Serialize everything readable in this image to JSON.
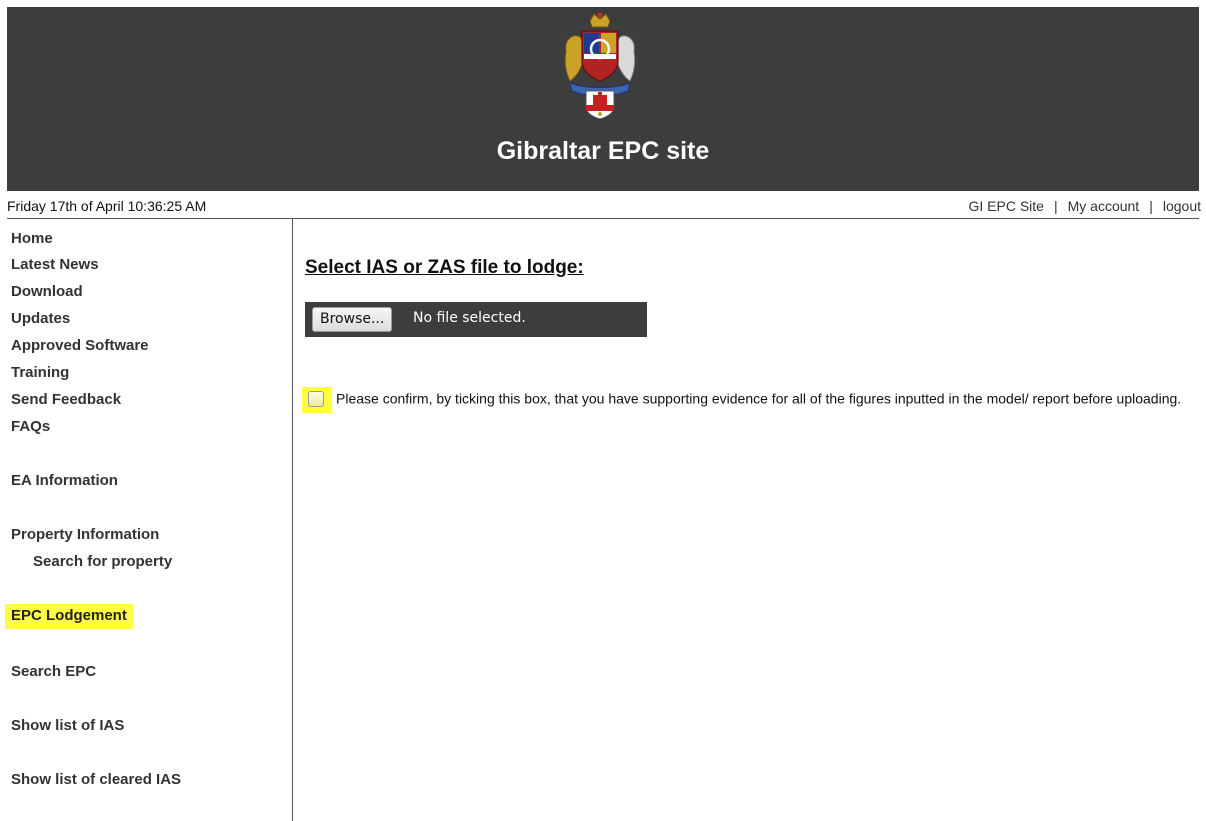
{
  "header": {
    "title": "Gibraltar EPC site",
    "crest": "Gibraltar coat of arms"
  },
  "infobar": {
    "datetime": "Friday 17th of April 10:36:25 AM",
    "links": [
      "GI EPC Site",
      "My account",
      "logout"
    ],
    "separator": "|"
  },
  "sidebar": {
    "items": [
      {
        "label": "Home"
      },
      {
        "label": "Latest News"
      },
      {
        "label": "Download"
      },
      {
        "label": "Updates"
      },
      {
        "label": "Approved Software"
      },
      {
        "label": "Training"
      },
      {
        "label": "Send Feedback"
      },
      {
        "label": "FAQs"
      },
      {
        "label": "EA Information"
      },
      {
        "label": "Property Information"
      },
      {
        "label": "Search for property"
      },
      {
        "label": "EPC Lodgement",
        "highlighted": true
      },
      {
        "label": "Search EPC"
      },
      {
        "label": "Show list of IAS"
      },
      {
        "label": "Show list of cleared IAS"
      }
    ]
  },
  "main": {
    "heading": "Select IAS or ZAS file to lodge:",
    "file_input": {
      "button_label": "Browse...",
      "status": "No file selected."
    },
    "confirm_text": "Please confirm, by ticking this box, that you have supporting evidence for all of the figures inputted in the model/ report before uploading.",
    "confirm_checked": false
  },
  "colors": {
    "header_bg": "#3d3d3d",
    "highlight": "#ffff44",
    "title_text": "#ffffff"
  }
}
